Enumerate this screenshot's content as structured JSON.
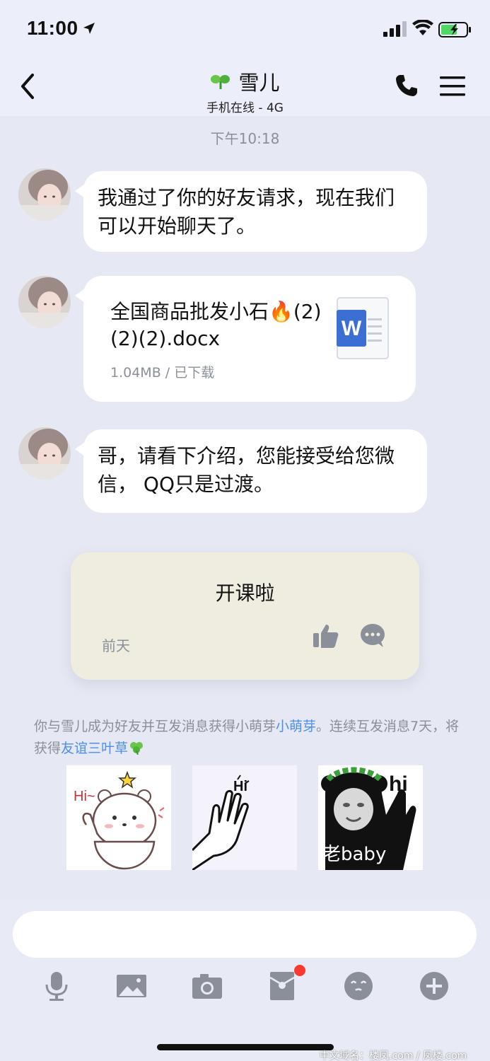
{
  "status_bar": {
    "time": "11:00"
  },
  "header": {
    "title": "雪儿",
    "subtitle": "手机在线 - 4G"
  },
  "chat": {
    "timestamp": "下午10:18",
    "messages": [
      {
        "type": "text",
        "text": "我通过了你的好友请求，现在我们可以开始聊天了。"
      },
      {
        "type": "file",
        "file_name": "全国商品批发小石🔥(2)(2)(2).docx",
        "meta": "1.04MB / 已下载",
        "icon": "word-doc-icon"
      },
      {
        "type": "text",
        "text": "哥，请看下介绍，您能接受给您微信， QQ只是过渡。"
      }
    ],
    "card": {
      "title": "开课啦",
      "date": "前天"
    },
    "system_note": {
      "prefix": "你与雪儿成为好友",
      "overlap": "并互发消息获得小萌芽",
      "link1": "小萌芽",
      "suffix": "。连续互发消息7天，将获得",
      "link2": "友谊三叶草"
    },
    "stickers": [
      {
        "caption": "Hi~"
      },
      {
        "caption": "Hi"
      },
      {
        "caption": "hi",
        "caption2": "老baby"
      }
    ]
  },
  "input": {
    "placeholder": ""
  },
  "toolbar": {
    "icons": [
      "microphone-icon",
      "image-icon",
      "camera-icon",
      "red-packet-icon",
      "emoji-icon",
      "plus-icon"
    ]
  },
  "footer": {
    "watermark": "中文域名：楼凤.com / 凤楼.com"
  },
  "colors": {
    "background": "#e6e9f4",
    "bubble": "#ffffff",
    "link": "#4a8ff0",
    "card": "#efece0",
    "badge": "#fa3a2f"
  }
}
